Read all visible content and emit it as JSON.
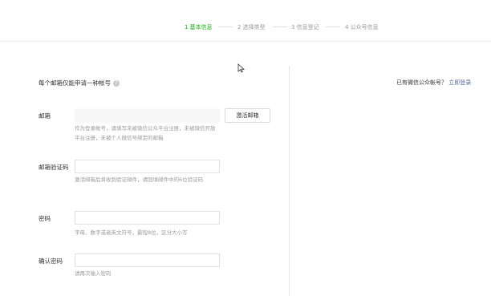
{
  "steps": [
    {
      "label": "1 基本信息",
      "active": true
    },
    {
      "label": "2 选择类型",
      "active": false
    },
    {
      "label": "3 信息登记",
      "active": false
    },
    {
      "label": "4 公众号信息",
      "active": false
    }
  ],
  "form": {
    "heading": "每个邮箱仅能申请一种帐号",
    "help_icon": "?",
    "email": {
      "label": "邮箱",
      "value": "",
      "hint": "作为登录帐号，请填写未被微信公众平台注册，未被微信开放平台注册，未被个人微信号绑定的邮箱",
      "activate_button": "激活邮箱"
    },
    "code": {
      "label": "邮箱验证码",
      "value": "",
      "hint": "激活邮箱后将收到验证邮件，请回填邮件中的6位验证码"
    },
    "password": {
      "label": "密码",
      "value": "",
      "hint": "字母、数字或者英文符号，最短8位，区分大小写"
    },
    "confirm": {
      "label": "确认密码",
      "value": "",
      "hint": "请再次输入密码"
    }
  },
  "sidebar": {
    "question": "已有微信公众帐号？",
    "login_link": "立即登录"
  },
  "colors": {
    "active_step": "#1aad19",
    "link": "#576b95",
    "hint": "#9a9a9a"
  }
}
